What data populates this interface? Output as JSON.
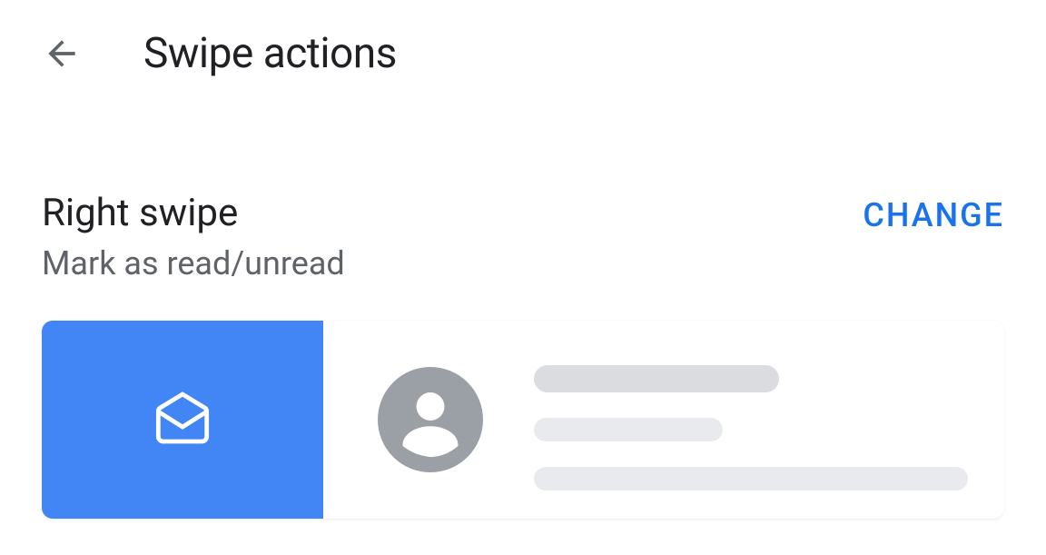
{
  "header": {
    "title": "Swipe actions"
  },
  "right_swipe": {
    "title": "Right swipe",
    "subtitle": "Mark as read/unread",
    "change_label": "CHANGE",
    "action_icon": "drafts-icon"
  },
  "colors": {
    "accent": "#4285f4",
    "link": "#1a73e8",
    "text_primary": "#202124",
    "text_secondary": "#5f6368",
    "placeholder": "#e8eaed",
    "placeholder_dark": "#dadce0"
  }
}
